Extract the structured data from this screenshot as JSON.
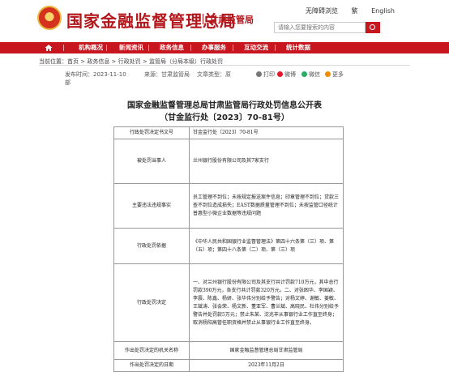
{
  "header": {
    "site_title": "国家金融监督管理总局",
    "bureau": "甘肃监管局",
    "accessibility": [
      "无障碍浏览",
      "繁",
      "English"
    ],
    "search_placeholder": "请输入您要搜索的内容"
  },
  "nav": {
    "items": [
      "机构概况",
      "新闻资讯",
      "政务信息",
      "办事服务",
      "互动交流",
      "统计数据"
    ]
  },
  "breadcrumb": "当前位置：首页 > 政务信息 > 行政处罚 > 监管局（分局本级）行政处罚",
  "meta": {
    "date_label": "发布时间：2023-11-10",
    "date_tail": "部",
    "source": "来源：甘肃监管局",
    "doc_type": "文章类型：原",
    "share": {
      "print": "打印",
      "weibo": "微博",
      "wechat": "微信",
      "more": "更多"
    },
    "share_colors": {
      "weibo": "#e6162d",
      "wechat": "#2aae67",
      "more": "#f08c00",
      "print": "#777777"
    }
  },
  "document": {
    "title_line1": "国家金融监督管理总局甘肃监管局行政处罚信息公开表",
    "title_line2": "（甘金监行处〔2023〕70-81号）",
    "rows": [
      {
        "label": "行政处罚决定书文号",
        "value": "甘金监行处〔2023〕70-81号"
      },
      {
        "label": "被处罚当事人",
        "value": "兰州银行股份有限公司及其7家支行"
      },
      {
        "label": "主要违法违规事实",
        "value": "员工管理不到位；未按规定报送案件信息；印章管理不到位；贷款三查不到位造成损失；EAST数据质量管理不到位；未按监管口径统计普惠型小微企业数据等违规问题"
      },
      {
        "label": "行政处罚依据",
        "value": "《中华人民共和国银行业监督管理法》第四十六条第（三）项、第（五）项；第四十八条第（二）项、第（三）项"
      },
      {
        "label": "行政处罚决定",
        "value": "一、对兰州银行股份有限公司及其支行共计罚款710万元，其中总行罚款390万元，各支行共计罚款320万元。二、对张困华、李国颖、李震、陈鑫、杨妍、张华伟分别给予警告；对杨文婷、谢敏、姜敏、王斌涛、张会荣、杨文新、董亚军、曹兰斌、高晓民、杜伟分别给予警告并处罚款5万元；禁止朱某、沈兆丰从事银行业工作直至终身；取消杨阳高管任职资格并禁止从事银行业工作直至终身。"
      },
      {
        "label": "作出处罚决定的机关名称",
        "value": "国家金融监督管理总局甘肃监管局"
      },
      {
        "label": "作出处罚决定的日期",
        "value": "2023年11月2日"
      }
    ]
  },
  "colors": {
    "brand_red": "#c7161d",
    "title_red": "#b3161b"
  }
}
